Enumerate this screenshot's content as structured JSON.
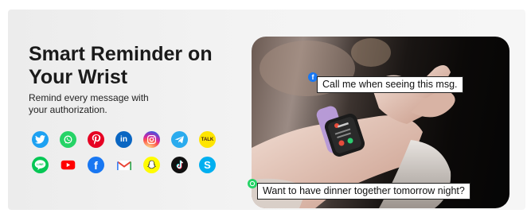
{
  "title_lines": [
    "Smart Reminder on",
    "Your Wrist"
  ],
  "subtitle_lines": [
    "Remind every message with",
    "your authorization."
  ],
  "icons_row1": [
    "twitter-icon",
    "whatsapp-icon",
    "pinterest-icon",
    "linkedin-icon",
    "instagram-icon",
    "telegram-icon",
    "kakaotalk-icon"
  ],
  "icons_row2": [
    "line-icon",
    "youtube-icon",
    "facebook-icon",
    "gmail-icon",
    "snapchat-icon",
    "tiktok-icon",
    "skype-icon"
  ],
  "icon_text": {
    "linkedin": "in",
    "kakao": "TALK",
    "line": "LINE",
    "facebook": "f",
    "skype": "S"
  },
  "bubbles": {
    "top": "Call me when seeing this msg.",
    "bottom": "Want to have dinner together tomorrow night?"
  },
  "colors": {
    "twitter": "#1da1f2",
    "whatsapp": "#25d366",
    "pinterest": "#e60023",
    "linkedin": "#0a66c2",
    "telegram": "#2aabee",
    "kakao": "#fee500",
    "line": "#06c755",
    "youtube": "#ff0000",
    "facebook": "#1877f2",
    "snapchat": "#fffc00",
    "skype": "#00aff0",
    "watch_band": "#b79ad6"
  }
}
